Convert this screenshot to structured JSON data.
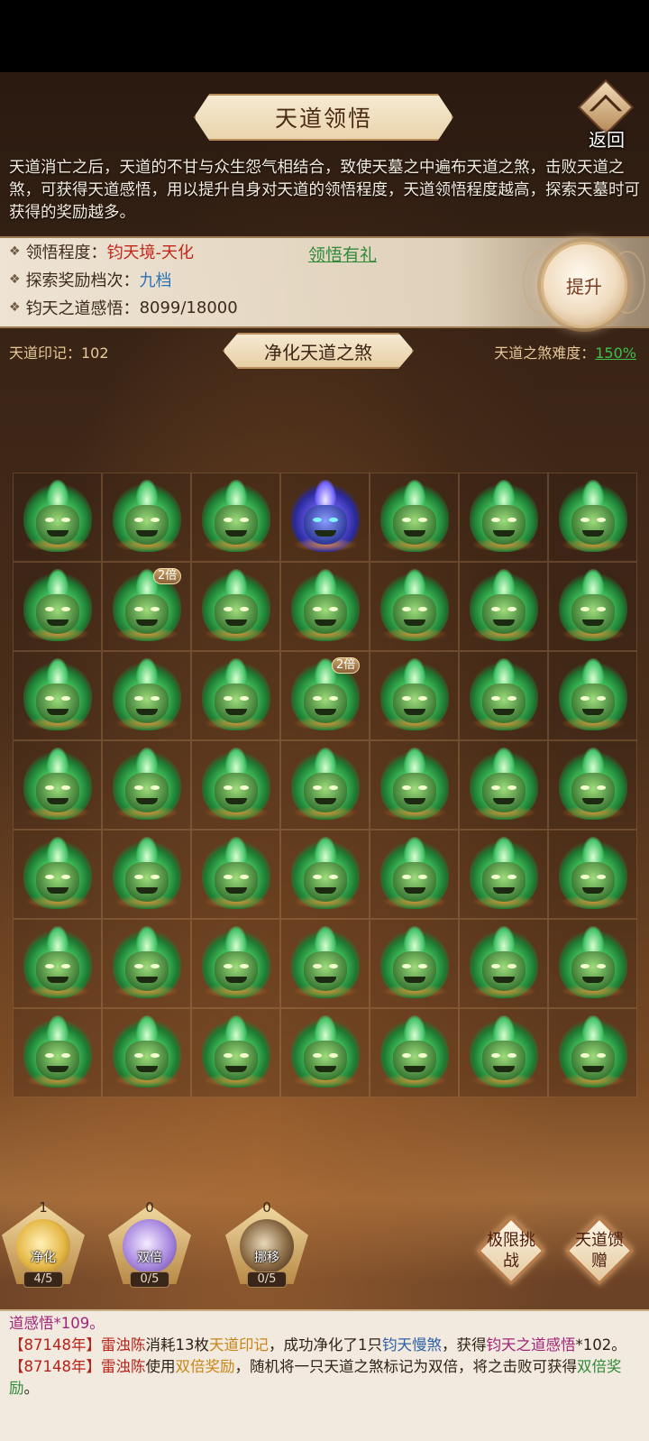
{
  "title": "天道领悟",
  "back_label": "返回",
  "description": "天道消亡之后，天道的不甘与众生怨气相结合，致使天墓之中遍布天道之煞，击败天道之煞，可获得天道感悟，用以提升自身对天道的领悟程度，天道领悟程度越高，探索天墓时可获得的奖励越多。",
  "info": {
    "rows": [
      {
        "label": "领悟程度：",
        "value": "钧天境-天化"
      },
      {
        "label": "探索奖励档次：",
        "value": "九档"
      },
      {
        "label": "钧天之道感悟：",
        "value": "8099/18000"
      }
    ],
    "gift_link": "领悟有礼",
    "upgrade_label": "提升"
  },
  "subbar": {
    "mark_label": "天道印记：102",
    "purify_title": "净化天道之煞",
    "difficulty_label": "天道之煞难度：",
    "difficulty_value": "150%"
  },
  "grid": {
    "rows": 7,
    "cols": 7,
    "special": {
      "blue_cell": 3
    },
    "badges": [
      {
        "cell": 8,
        "text": "2倍"
      },
      {
        "cell": 17,
        "text": "2倍"
      }
    ]
  },
  "actions": [
    {
      "count": "1",
      "label": "净化",
      "progress": "4/5",
      "orb": "gold"
    },
    {
      "count": "0",
      "label": "双倍",
      "progress": "0/5",
      "orb": "purple"
    },
    {
      "count": "0",
      "label": "挪移",
      "progress": "0/5",
      "orb": "dark"
    }
  ],
  "diamond_buttons": [
    {
      "label": "极限挑战"
    },
    {
      "label": "天道馈赠"
    }
  ],
  "log": {
    "line0": "道感悟*109。",
    "line1": {
      "tag": "【87148年】",
      "player": "雷浊陈",
      "t1": "消耗13枚",
      "item": "天道印记",
      "t2": "，成功净化了1只",
      "monster": "钧天慢煞",
      "t3": "，获得",
      "reward": "钧天之道感悟",
      "t4": "*102。"
    },
    "line2": {
      "tag": "【87148年】",
      "player": "雷浊陈",
      "t1": "使用",
      "item": "双倍奖励",
      "t2": "，随机将一只天道之煞标记为双倍，将之击败可获得",
      "reward": "双倍奖励",
      "t3": "。"
    }
  },
  "colors": {
    "accent_gold": "#c98416",
    "status_red": "#c2261c",
    "status_blue": "#2d72b8",
    "status_green": "#2f8a3a",
    "demon_green": "#4bd066",
    "demon_blue": "#6a5cf0"
  }
}
